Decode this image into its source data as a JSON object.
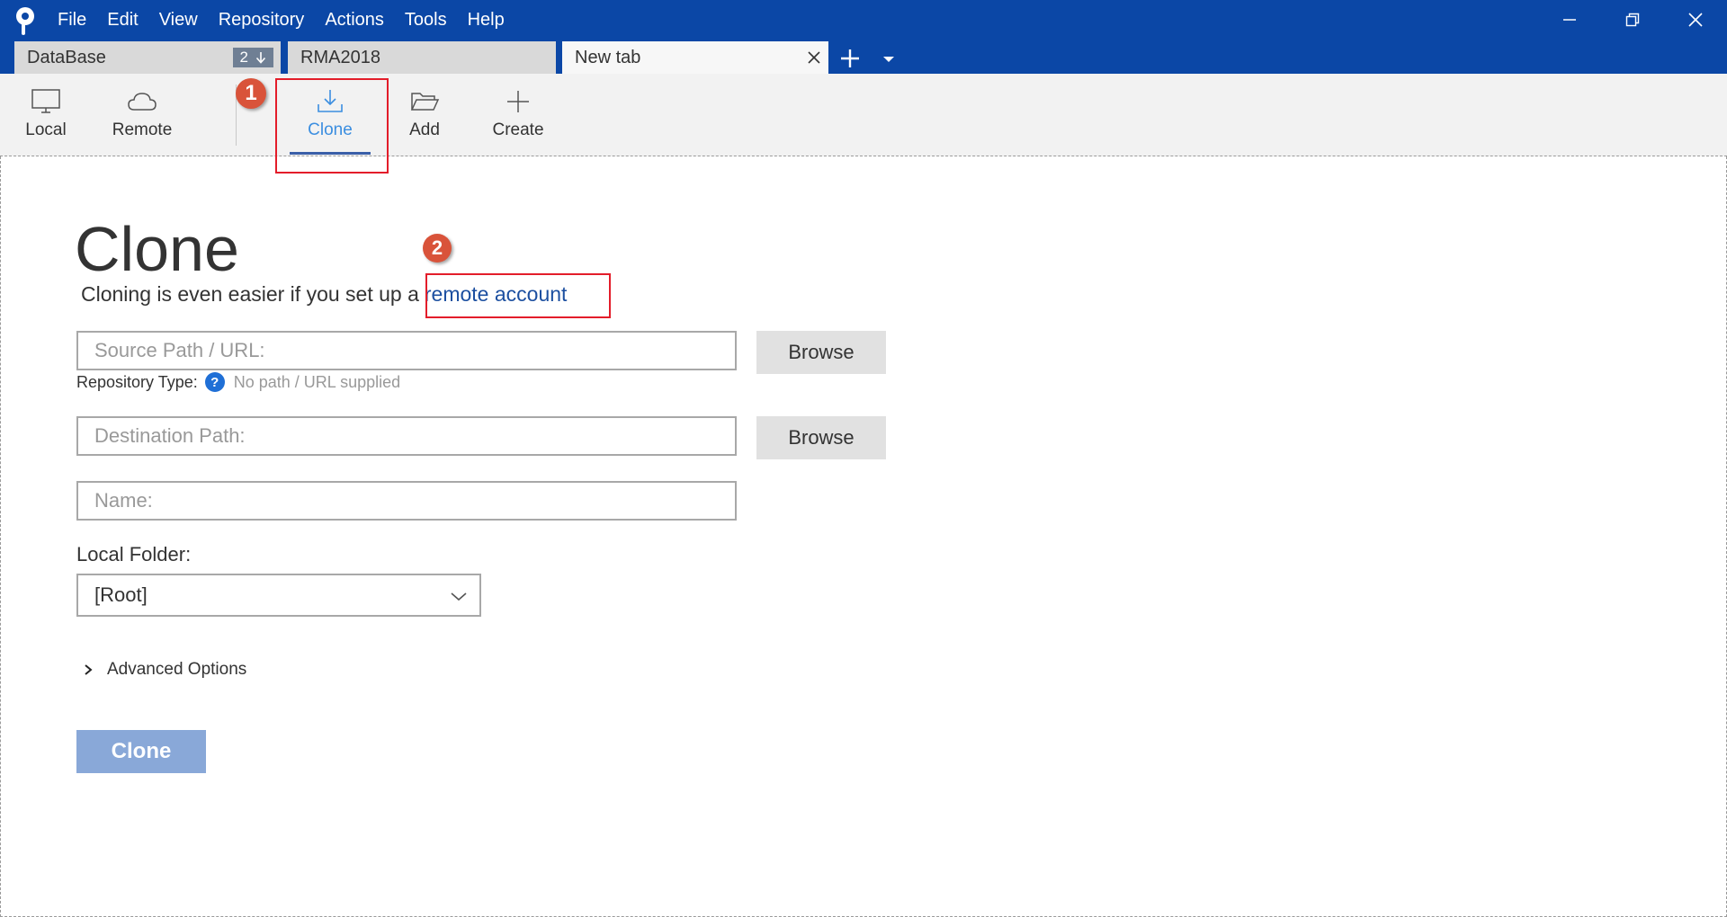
{
  "menu": [
    {
      "label": "File"
    },
    {
      "label": "Edit"
    },
    {
      "label": "View"
    },
    {
      "label": "Repository"
    },
    {
      "label": "Actions"
    },
    {
      "label": "Tools"
    },
    {
      "label": "Help"
    }
  ],
  "tabs": [
    {
      "label": "DataBase",
      "badge_count": "2"
    },
    {
      "label": "RMA2018"
    },
    {
      "label": "New tab"
    }
  ],
  "toolbar": {
    "local": "Local",
    "remote": "Remote",
    "clone": "Clone",
    "add": "Add",
    "create": "Create"
  },
  "annotations": {
    "one": "1",
    "two": "2"
  },
  "clone_page": {
    "title": "Clone",
    "subtitle_prefix": "Cloning is even easier if you set up a",
    "subtitle_link": "remote account",
    "source_placeholder": "Source Path / URL:",
    "browse_label": "Browse",
    "repo_type_label": "Repository Type:",
    "repo_type_help": "?",
    "repo_type_status": "No path / URL supplied",
    "destination_placeholder": "Destination Path:",
    "name_placeholder": "Name:",
    "local_folder_label": "Local Folder:",
    "local_folder_value": "[Root]",
    "advanced_options": "Advanced Options",
    "clone_button": "Clone"
  },
  "colors": {
    "titlebar": "#0b47a6",
    "accent": "#3b8ee0",
    "link": "#1c4fa0",
    "annotation_red": "#e31d2a",
    "clone_button": "#89a8d8"
  }
}
